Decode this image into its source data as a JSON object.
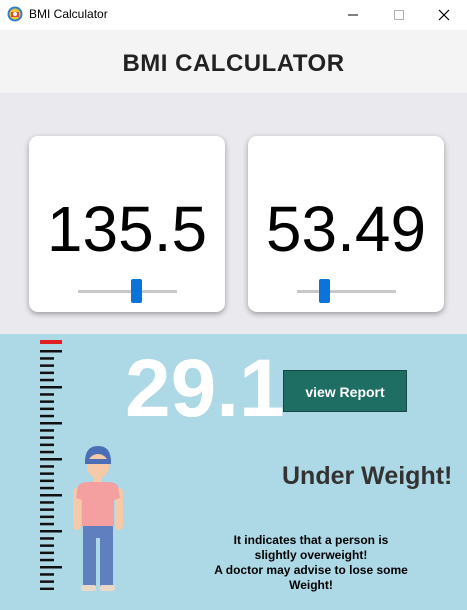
{
  "window": {
    "title": "BMI Calculator",
    "controls": [
      "minimize",
      "maximize",
      "close"
    ]
  },
  "header": {
    "title": "BMI CALCULATOR"
  },
  "height_card": {
    "value": "135.5",
    "slider_level": 0.55
  },
  "weight_card": {
    "value": "53.49",
    "slider_level": 0.28
  },
  "result": {
    "bmi": "29.1",
    "report_button_label": "view Report",
    "status": "Under Weight!",
    "description_lines": [
      "It indicates that a person is",
      "slightly overweight!",
      "A doctor may advise to lose some",
      "Weight!"
    ]
  },
  "colors": {
    "header_bg": "#f4f4f4",
    "cards_bg": "#eaeaee",
    "result_bg": "#add8e6",
    "accent_button": "#1f6e64",
    "slider_thumb": "#0a74da",
    "ruler_marker": "#e02020"
  },
  "icons": {
    "app": "bmi-app-icon",
    "person": "person-illustration",
    "ruler": "height-ruler"
  }
}
